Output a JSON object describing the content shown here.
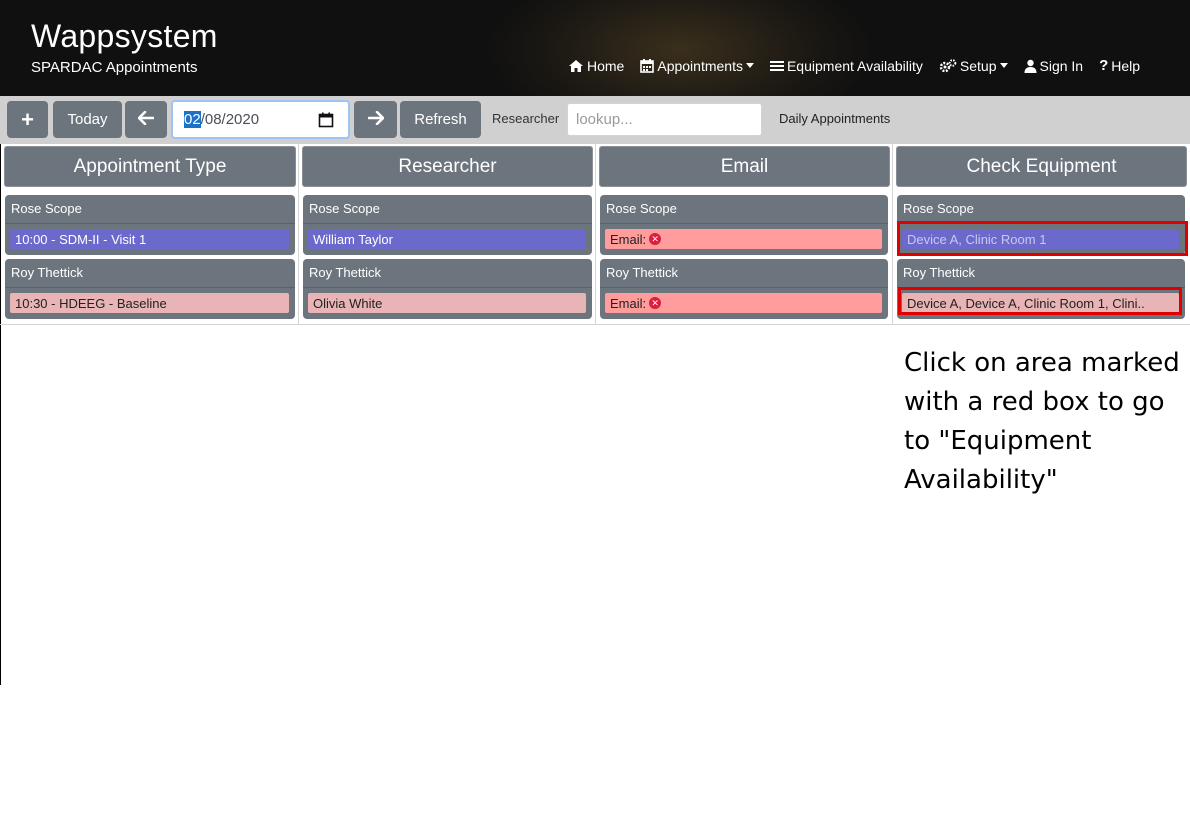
{
  "header": {
    "title": "Wappsystem",
    "subtitle": "SPARDAC Appointments",
    "nav": [
      {
        "label": "Home",
        "icon": "home-icon"
      },
      {
        "label": "Appointments",
        "icon": "calendar-icon",
        "dropdown": true
      },
      {
        "label": "Equipment Availability",
        "icon": "list-icon"
      },
      {
        "label": "Setup",
        "icon": "gears-icon",
        "dropdown": true
      },
      {
        "label": "Sign In",
        "icon": "user-icon"
      },
      {
        "label": "Help",
        "icon": "question-icon"
      }
    ]
  },
  "toolbar": {
    "add_label": "+",
    "today_label": "Today",
    "date_selected": "02",
    "date_rest": "/08/2020",
    "refresh_label": "Refresh",
    "researcher_label": "Researcher",
    "researcher_placeholder": "lookup...",
    "mode_label": "Daily Appointments"
  },
  "columns": {
    "appointment_type": "Appointment Type",
    "researcher": "Researcher",
    "email": "Email",
    "check_equipment": "Check Equipment"
  },
  "rows": [
    {
      "name": "Rose Scope",
      "appointment": "10:00 - SDM-II - Visit 1",
      "researcher": "William Taylor",
      "email_label": "Email:",
      "equipment": "Device A, Clinic Room 1"
    },
    {
      "name": "Roy Thettick",
      "appointment": "10:30 - HDEEG - Baseline",
      "researcher": "Olivia White",
      "email_label": "Email:",
      "equipment": "Device A, Device A, Clinic Room 1, Clini.."
    }
  ],
  "note": "Click on area marked with a red box to go to \"Equipment Availability\"",
  "colors": {
    "header_bg": "#151515",
    "toolbar_bg": "#d0d0d0",
    "button_gray": "#6c757d",
    "appt_blue": "#6c69cc",
    "appt_pink": "#e8b4b6",
    "email_red": "#ff9c9c",
    "highlight_red": "#e00000"
  }
}
